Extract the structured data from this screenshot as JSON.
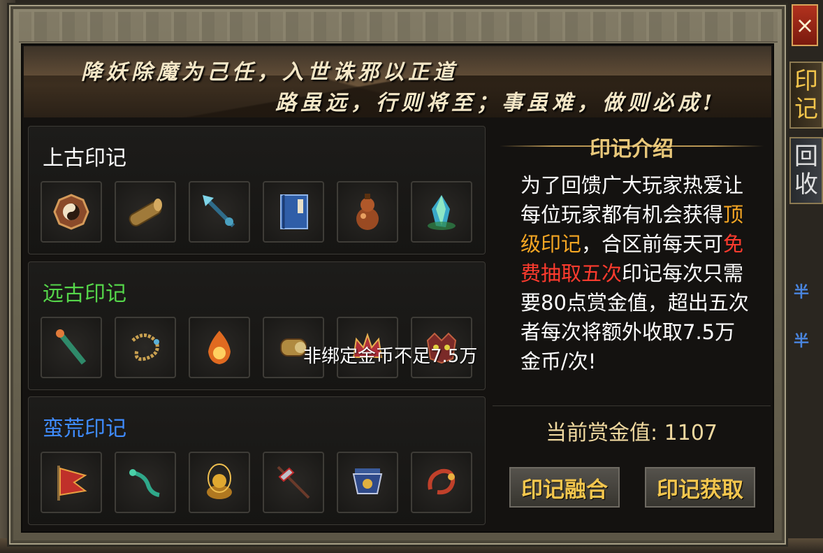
{
  "banner": {
    "line1": "降妖除魔为己任，入世诛邪以正道",
    "line2": "路虽远，行则将至；事虽难，做则必成!"
  },
  "close_label": "×",
  "side_tabs": [
    {
      "label_top": "印",
      "label_bottom": "记"
    },
    {
      "label_top": "回",
      "label_bottom": "收"
    }
  ],
  "sections": [
    {
      "title": "上古印记",
      "color": "#ffffff",
      "items": [
        "bagua-icon",
        "scroll-icon",
        "spear-icon",
        "book-icon",
        "gourd-icon",
        "crystal-icon"
      ]
    },
    {
      "title": "远古印记",
      "color": "#55d64a",
      "items": [
        "jade-staff-icon",
        "beads-icon",
        "flame-orb-icon",
        "scroll-drum-icon",
        "crown-icon",
        "demon-mask-icon"
      ]
    },
    {
      "title": "蛮荒印记",
      "color": "#3f8cff",
      "items": [
        "banner-icon",
        "green-rod-icon",
        "buddha-icon",
        "halberd-icon",
        "cauldron-icon",
        "dragon-icon"
      ]
    }
  ],
  "tooltip": "非绑定金币不足7.5万",
  "intro": {
    "title": "印记介绍",
    "text_a": "为了回馈广大玩家热爱让每位玩家都有机会获得",
    "highlight1": "顶级印记",
    "text_b": "，合区前每天可",
    "highlight2": "免费抽取五次",
    "text_c": "印记每次只需要80点赏金值，超出五次者每次将额外收取7.5万金币/次!"
  },
  "bounty": {
    "label": "当前赏金值:",
    "value": "1107"
  },
  "buttons": {
    "fuse": "印记融合",
    "obtain": "印记获取"
  }
}
